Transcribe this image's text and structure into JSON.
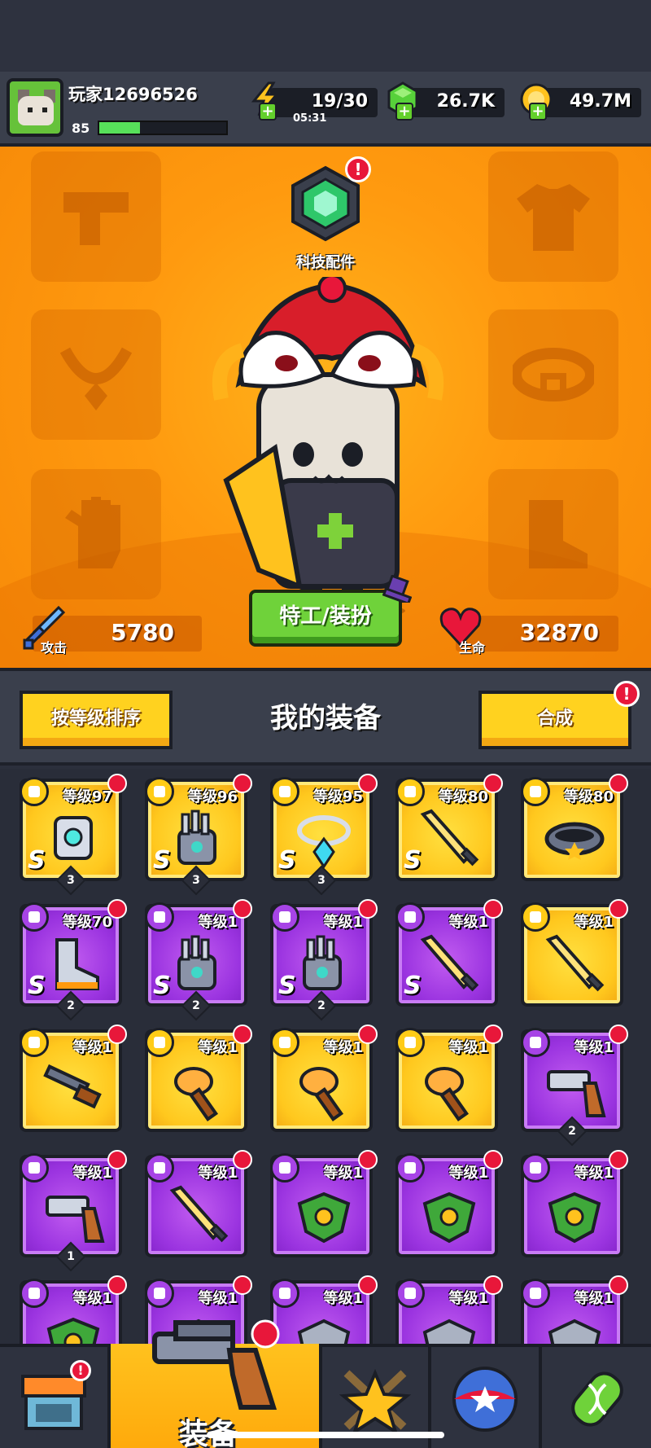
{
  "player": {
    "name": "玩家12696526",
    "level": "85",
    "xp_fraction": 0.32
  },
  "resources": {
    "energy": {
      "value": "19/30",
      "timer": "05:31",
      "icon": "lightning-icon"
    },
    "gems": {
      "value": "26.7K",
      "icon": "green-gem-icon"
    },
    "coins": {
      "value": "49.7M",
      "icon": "gold-coin-icon"
    }
  },
  "hero": {
    "tech_label": "科技配件",
    "tech_alert": "!",
    "agent_button": "特工/装扮",
    "attack_label": "攻击",
    "attack_value": "5780",
    "life_label": "生命",
    "life_value": "32870",
    "slots": [
      "weapon-slot",
      "armor-slot",
      "necklace-slot",
      "belt-slot",
      "gloves-slot",
      "boots-slot"
    ]
  },
  "equipment": {
    "sort_button": "按等级排序",
    "title": "我的装备",
    "merge_button": "合成",
    "merge_alert": "!"
  },
  "items": [
    {
      "level": "等级97",
      "rarity": "gold",
      "rank": "S",
      "stars": "3",
      "kind": "armor"
    },
    {
      "level": "等级96",
      "rarity": "gold",
      "rank": "S",
      "stars": "3",
      "kind": "glove"
    },
    {
      "level": "等级95",
      "rarity": "gold",
      "rank": "S",
      "stars": "3",
      "kind": "necklace"
    },
    {
      "level": "等级80",
      "rarity": "gold",
      "rank": "S",
      "stars": "",
      "kind": "sword"
    },
    {
      "level": "等级80",
      "rarity": "gold",
      "rank": "",
      "stars": "",
      "kind": "belt"
    },
    {
      "level": "等级70",
      "rarity": "purple",
      "rank": "S",
      "stars": "2",
      "kind": "boot"
    },
    {
      "level": "等级1",
      "rarity": "purple",
      "rank": "S",
      "stars": "2",
      "kind": "glove"
    },
    {
      "level": "等级1",
      "rarity": "purple",
      "rank": "S",
      "stars": "2",
      "kind": "glove"
    },
    {
      "level": "等级1",
      "rarity": "purple",
      "rank": "S",
      "stars": "",
      "kind": "sword"
    },
    {
      "level": "等级1",
      "rarity": "gold",
      "rank": "",
      "stars": "",
      "kind": "sword"
    },
    {
      "level": "等级1",
      "rarity": "gold",
      "rank": "",
      "stars": "",
      "kind": "shotgun"
    },
    {
      "level": "等级1",
      "rarity": "gold",
      "rank": "",
      "stars": "",
      "kind": "club"
    },
    {
      "level": "等级1",
      "rarity": "gold",
      "rank": "",
      "stars": "",
      "kind": "club"
    },
    {
      "level": "等级1",
      "rarity": "gold",
      "rank": "",
      "stars": "",
      "kind": "club"
    },
    {
      "level": "等级1",
      "rarity": "purple",
      "rank": "",
      "stars": "2",
      "kind": "revolver"
    },
    {
      "level": "等级1",
      "rarity": "purple",
      "rank": "",
      "stars": "1",
      "kind": "revolver"
    },
    {
      "level": "等级1",
      "rarity": "purple",
      "rank": "",
      "stars": "",
      "kind": "sword"
    },
    {
      "level": "等级1",
      "rarity": "purple",
      "rank": "",
      "stars": "",
      "kind": "leaf-armor"
    },
    {
      "level": "等级1",
      "rarity": "purple",
      "rank": "",
      "stars": "",
      "kind": "leaf-armor"
    },
    {
      "level": "等级1",
      "rarity": "purple",
      "rank": "",
      "stars": "",
      "kind": "leaf-armor"
    },
    {
      "level": "等级1",
      "rarity": "purple",
      "rank": "",
      "stars": "",
      "kind": "leaf-armor"
    },
    {
      "level": "等级1",
      "rarity": "purple",
      "rank": "",
      "stars": "",
      "kind": "rock-armor"
    },
    {
      "level": "等级1",
      "rarity": "purple",
      "rank": "",
      "stars": "",
      "kind": "rock-armor"
    },
    {
      "level": "等级1",
      "rarity": "purple",
      "rank": "",
      "stars": "",
      "kind": "rock-armor"
    },
    {
      "level": "等级1",
      "rarity": "purple",
      "rank": "",
      "stars": "",
      "kind": "rock-armor"
    }
  ],
  "nav": {
    "shop_icon": "shop-icon",
    "equip_label": "装备",
    "stars_icon": "star-swords-icon",
    "ball_icon": "star-ball-icon",
    "dna_icon": "dna-capsule-icon"
  },
  "colors": {
    "orange": "#ff9a0f",
    "gold": "#ffc81e",
    "purple": "#9b34e0",
    "green": "#6fd23a",
    "alert": "#e8173a"
  }
}
